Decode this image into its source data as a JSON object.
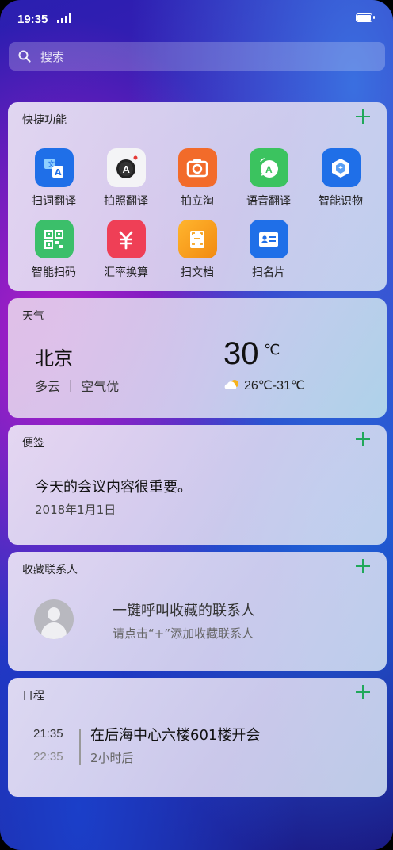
{
  "status_bar": {
    "time": "19:35"
  },
  "search": {
    "placeholder": "搜索"
  },
  "quick_functions": {
    "title": "快捷功能",
    "apps": [
      {
        "label": "扫词翻译",
        "icon": "scan-translate-icon",
        "color": "#1f6fe8"
      },
      {
        "label": "拍照翻译",
        "icon": "photo-translate-icon",
        "color": "#f4f4f6"
      },
      {
        "label": "拍立淘",
        "icon": "camera-icon",
        "color": "#f26b2a"
      },
      {
        "label": "语音翻译",
        "icon": "voice-translate-icon",
        "color": "#3bc35f"
      },
      {
        "label": "智能识物",
        "icon": "object-recognition-icon",
        "color": "#1f6fe8"
      },
      {
        "label": "智能扫码",
        "icon": "qr-scan-icon",
        "color": "#3bbf6a"
      },
      {
        "label": "汇率换算",
        "icon": "currency-icon",
        "color": "#ef3f56"
      },
      {
        "label": "扫文档",
        "icon": "scan-document-icon",
        "color": "#f7a21b"
      },
      {
        "label": "扫名片",
        "icon": "business-card-icon",
        "color": "#1f6fe8"
      }
    ]
  },
  "weather": {
    "title": "天气",
    "city": "北京",
    "condition": "多云 ｜ 空气优",
    "temperature": "30",
    "unit": "℃",
    "range": "26℃-31℃"
  },
  "notes": {
    "title": "便签",
    "body": "今天的会议内容很重要。",
    "date": "2018年1月1日"
  },
  "favorite_contacts": {
    "title": "收藏联系人",
    "main": "一键呼叫收藏的联系人",
    "hint": "请点击“+”添加收藏联系人"
  },
  "schedule": {
    "title": "日程",
    "start": "21:35",
    "end": "22:35",
    "event": "在后海中心六楼601楼开会",
    "duration": "2小时后"
  }
}
